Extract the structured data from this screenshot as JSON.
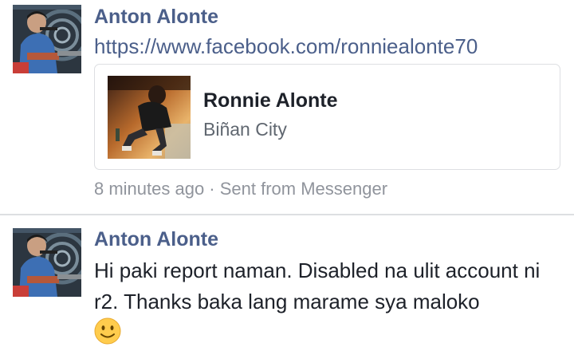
{
  "messages": [
    {
      "sender": "Anton Alonte",
      "avatar_icon": "profile-photo",
      "link_text": "https://www.facebook.com/ronniealonte70",
      "link_preview": {
        "thumbnail_icon": "profile-photo-thumbnail",
        "title": "Ronnie Alonte",
        "subtitle": "Biñan City"
      },
      "meta": "8 minutes ago · Sent from Messenger"
    },
    {
      "sender": "Anton Alonte",
      "avatar_icon": "profile-photo",
      "text": "Hi paki report naman. Disabled na ulit account ni r2. Thanks baka lang marame sya maloko",
      "emoji": "slightly-smiling-face"
    }
  ],
  "colors": {
    "name_link": "#4b5f8a",
    "body_text": "#1d2129",
    "meta_text": "#90949c",
    "divider": "#dddfe2",
    "emoji_yellow": "#ffcc4d"
  }
}
